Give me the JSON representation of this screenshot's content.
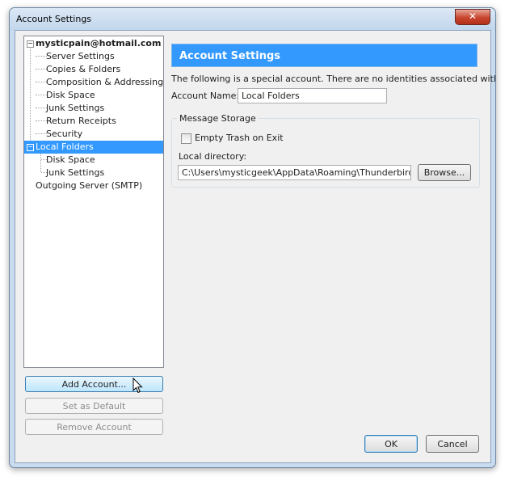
{
  "window": {
    "title": "Account Settings",
    "close_glyph": "✕"
  },
  "tree": {
    "account": "mysticpain@hotmail.com",
    "account_items": [
      "Server Settings",
      "Copies & Folders",
      "Composition & Addressing",
      "Disk Space",
      "Junk Settings",
      "Return Receipts",
      "Security"
    ],
    "local_folders": "Local Folders",
    "local_items": [
      "Disk Space",
      "Junk Settings"
    ],
    "smtp": "Outgoing Server (SMTP)",
    "expander_glyph": "−"
  },
  "buttons": {
    "add_account": "Add Account...",
    "set_default": "Set as Default",
    "remove_account": "Remove Account",
    "ok": "OK",
    "cancel": "Cancel",
    "browse": "Browse..."
  },
  "panel": {
    "header": "Account Settings",
    "description": "The following is a special account. There are no identities associated with it.",
    "account_name_label": "Account Name:",
    "account_name_value": "Local Folders",
    "storage_legend": "Message Storage",
    "empty_trash_label": "Empty Trash on Exit",
    "local_directory_label": "Local directory:",
    "local_directory_value": "C:\\Users\\mysticgeek\\AppData\\Roaming\\Thunderbird\\Profil"
  },
  "colors": {
    "selection": "#3399ff",
    "frame": "#c9dcef"
  },
  "icons": [
    "close-icon",
    "expander-icon",
    "mouse-pointer-icon"
  ]
}
